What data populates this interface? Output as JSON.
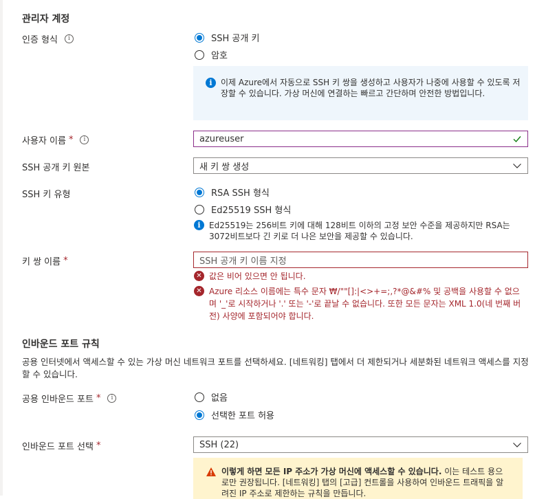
{
  "admin": {
    "title": "관리자 계정",
    "auth_label": "인증 형식",
    "auth_options": [
      "SSH 공개 키",
      "암호"
    ],
    "auth_info": "이제 Azure에서 자동으로 SSH 키 쌍을 생성하고 사용자가 나중에 사용할 수 있도록 저장할 수 있습니다. 가상 머신에 연결하는 빠르고 간단하며 안전한 방법입니다.",
    "username_label": "사용자 이름",
    "username_value": "azureuser",
    "ssh_source_label": "SSH 공개 키 원본",
    "ssh_source_value": "새 키 쌍 생성",
    "ssh_type_label": "SSH 키 유형",
    "ssh_type_options": [
      "RSA SSH 형식",
      "Ed25519 SSH 형식"
    ],
    "ssh_type_info": "Ed25519는 256비트 키에 대해 128비트 이하의 고정 보안 수준을 제공하지만 RSA는 3072비트보다 긴 키로 더 나은 보안을 제공할 수 있습니다.",
    "keypair_label": "키 쌍 이름",
    "keypair_placeholder": "SSH 공개 키 이름 지정",
    "error_empty": "값은 비어 있으면 안 됩니다.",
    "error_chars": "Azure 리소스 이름에는 특수 문자 ₩/\"\"[]:|<>+=;,?*@&#% 및 공백을 사용할 수 없으며 '_'로 시작하거나 '.' 또는 '-'로 끝날 수 없습니다. 또한 모든 문자는 XML 1.0(네 번째 버전) 사양에 포함되어야 합니다.",
    "required_mark": "*",
    "info_glyph": "i"
  },
  "inbound": {
    "title": "인바운드 포트 규칙",
    "description": "공용 인터넷에서 액세스할 수 있는 가상 머신 네트워크 포트를 선택하세요. [네트워킹] 탭에서 더 제한되거나 세분화된 네트워크 액세스를 지정할 수 있습니다.",
    "public_ports_label": "공용 인바운드 포트",
    "public_ports_options": [
      "없음",
      "선택한 포트 허용"
    ],
    "select_ports_label": "인바운드 포트 선택",
    "select_ports_value": "SSH (22)",
    "warning_bold": "이렇게 하면 모든 IP 주소가 가상 머신에 액세스할 수 있습니다.",
    "warning_text": " 이는 테스트 용으로만 권장됩니다.  [네트워킹] 탭의 [고급] 컨트롤을 사용하여 인바운드 트래픽을 알려진 IP 주소로 제한하는 규칙을 만듭니다."
  },
  "colors": {
    "accent": "#0078d4",
    "error": "#a4262c",
    "valid": "#107c10",
    "warning": "#d83b01",
    "info_bg": "#eff6fc",
    "warning_bg": "#fff4ce"
  },
  "icons": [
    "info-icon",
    "checkmark-icon",
    "chevron-down-icon",
    "error-icon",
    "warning-icon"
  ]
}
